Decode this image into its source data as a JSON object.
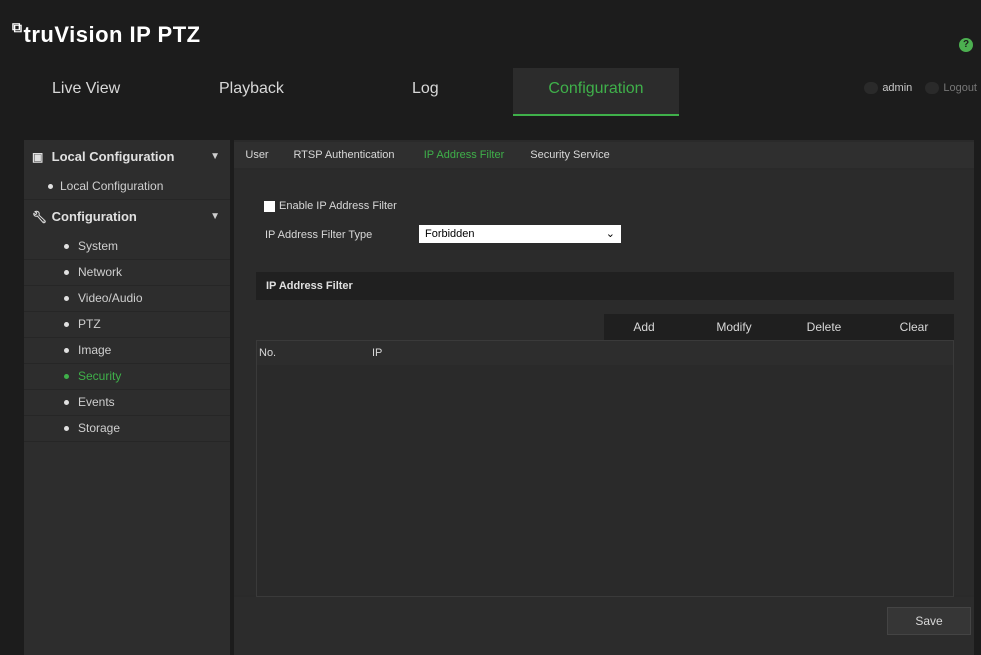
{
  "app": {
    "logo_mark": "⧉",
    "logo_text": "truVision  IP PTZ",
    "help_icon": "?"
  },
  "nav": {
    "items": [
      {
        "label": "Live View"
      },
      {
        "label": "Playback"
      },
      {
        "label": "Log"
      },
      {
        "label": "Configuration",
        "active": true
      }
    ],
    "user": "admin",
    "logout": "Logout"
  },
  "sidebar": {
    "local_section": {
      "label": "Local Configuration",
      "items": [
        {
          "label": "Local Configuration"
        }
      ]
    },
    "config_section": {
      "label": "Configuration",
      "items": [
        {
          "label": "System"
        },
        {
          "label": "Network"
        },
        {
          "label": "Video/Audio"
        },
        {
          "label": "PTZ"
        },
        {
          "label": "Image"
        },
        {
          "label": "Security",
          "active": true
        },
        {
          "label": "Events"
        },
        {
          "label": "Storage"
        }
      ]
    }
  },
  "tabs": [
    {
      "label": "User"
    },
    {
      "label": "RTSP Authentication"
    },
    {
      "label": "IP Address Filter",
      "active": true
    },
    {
      "label": "Security Service"
    }
  ],
  "form": {
    "enable_label": "Enable IP Address Filter",
    "enable_checked": false,
    "type_label": "IP Address Filter Type",
    "type_value": "Forbidden"
  },
  "filter": {
    "title": "IP Address Filter",
    "actions": {
      "add": "Add",
      "modify": "Modify",
      "delete": "Delete",
      "clear": "Clear"
    },
    "columns": {
      "no": "No.",
      "ip": "IP"
    },
    "rows": []
  },
  "footer": {
    "save": "Save"
  },
  "colors": {
    "accent": "#3fb04a",
    "background": "#1c1c1c"
  }
}
